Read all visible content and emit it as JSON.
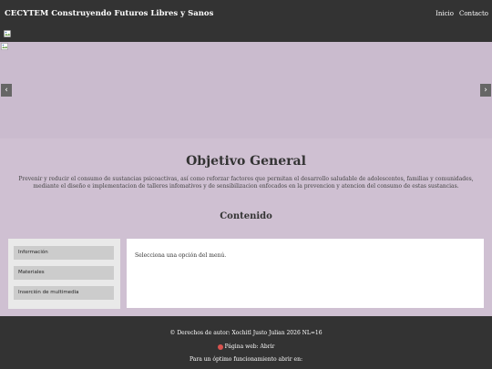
{
  "navbar": {
    "brand": "CECYTEM Construyendo Futuros Libres y Sanos",
    "links": [
      "Inicio",
      "Contacto"
    ]
  },
  "carousel": {
    "prev_label": "‹",
    "next_label": "›"
  },
  "objective": {
    "title": "Objetivo General",
    "text": "Prevenir y reducir el consumo de sustancias psicoactivas, así como reforzar factores que permitan el desarrollo saludable de adolescentes, familias y comunidades, mediante el diseño e implementacion de talleres infomativos y de sensibilizacion enfocados en la prevencion y atencion del consumo de estas sustancias."
  },
  "contenido": {
    "title": "Contenido",
    "menu": [
      "Información",
      "Materiales",
      "Inserción de multimedia"
    ],
    "message": "Selecciona una opción del menú."
  },
  "footer": {
    "copyright": "© Derechos de autor: Xochitl Justo Julian 2026 NL=16",
    "web": "Página web: Abrir",
    "optimal": "Para un óptimo funcionamiento abrir en:"
  },
  "colors": {
    "navbar_bg": "#333333",
    "page_bg": "#cfc0d2",
    "footer_bg": "#333333"
  }
}
